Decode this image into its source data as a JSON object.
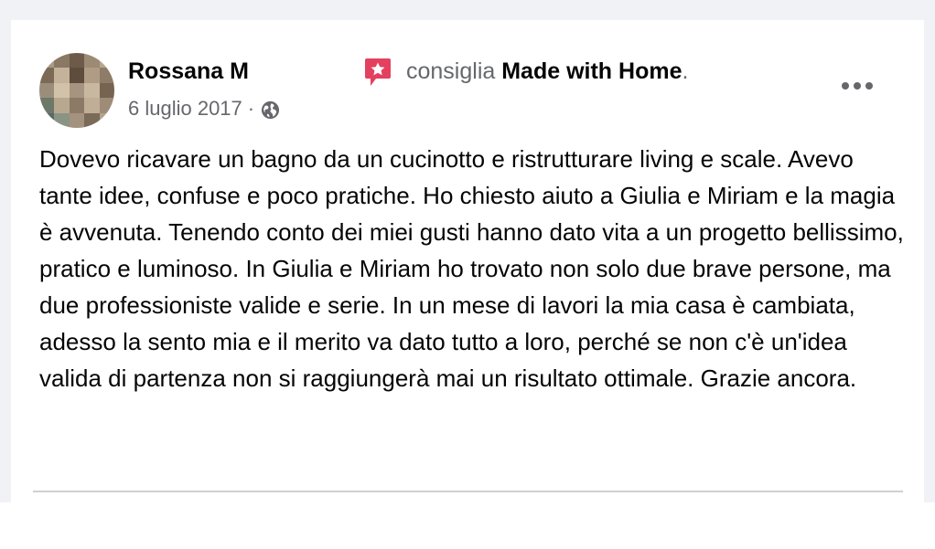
{
  "post": {
    "author": "Rossana M",
    "recommends_text": "consiglia",
    "page_name": "Made with Home",
    "page_suffix": ".",
    "date": "6 luglio 2017",
    "separator": "·",
    "privacy_icon": "globe-icon",
    "recommend_icon": "recommend-star-icon",
    "more_icon": "more-options-icon",
    "body": "Dovevo ricavare un bagno da un cucinotto e ristrutturare living e scale. Avevo tante idee, confuse e poco pratiche. Ho chiesto aiuto a Giulia e Miriam e la magia è avvenuta. Tenendo conto dei miei gusti hanno dato vita a un progetto bellissimo, pratico e luminoso. In Giulia e Miriam ho trovato non solo due brave persone, ma due professioniste valide e serie. In un mese di lavori la mia casa è cambiata, adesso la sento mia e il merito va dato tutto a loro, perché se non c'è un'idea valida di partenza non si raggiungerà mai un risultato ottimale. Grazie ancora."
  },
  "colors": {
    "background": "#f0f2f5",
    "card": "#ffffff",
    "primary_text": "#050505",
    "secondary_text": "#65676b",
    "recommend_red": "#e4405f",
    "divider": "#ced0d4"
  }
}
